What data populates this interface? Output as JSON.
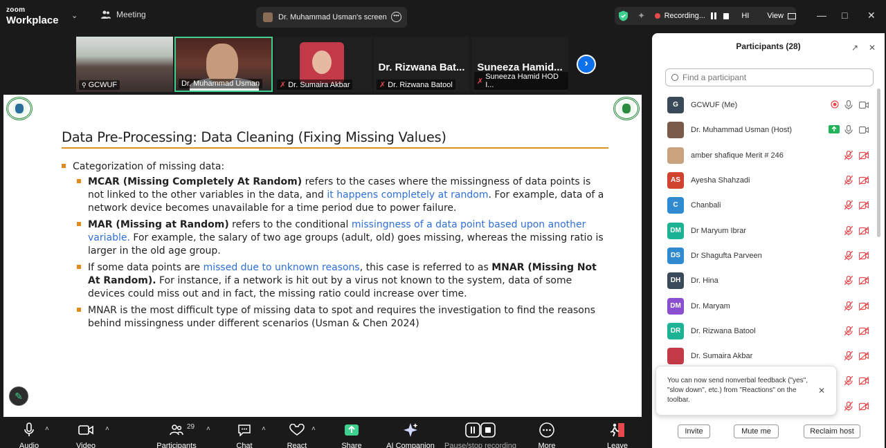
{
  "top": {
    "brand_small": "zoom",
    "brand_large": "Workplace",
    "meeting_tab": "Meeting",
    "screen_tab": "Dr. Muhammad Usman's screen",
    "recording_label": "Recording...",
    "hi_label": "HI",
    "view_label": "View"
  },
  "videos": {
    "tile1": "GCWUF",
    "tile2": "Dr. Muhammad Usman",
    "tile3": "Dr. Sumaira Akbar",
    "tile4_big": "Dr. Rizwana Bat...",
    "tile4": "Dr. Rizwana Batool",
    "tile5_big": "Suneeza Hamid...",
    "tile5": "Suneeza Hamid HOD I..."
  },
  "slide": {
    "title": "Data Pre-Processing: Data Cleaning (Fixing Missing Values)",
    "b0": "Categorization of missing data:",
    "b1_bold": "MCAR (Missing Completely At Random)",
    "b1_t1": " refers to the cases where the missingness of data points is not linked to the other variables in the data, and ",
    "b1_blue": "it happens completely at random",
    "b1_t2": ". For example, data of a network device becomes unavailable for a time period due to power failure.",
    "b2_bold": "MAR (Missing at Random)",
    "b2_t1": " refers to the conditional ",
    "b2_blue": "missingness of a data point based upon another variable.",
    "b2_t2": " For example, the salary of two age groups (adult, old) goes missing, whereas the missing ratio is larger in the old age group.",
    "b3_t1": "If some data points are ",
    "b3_blue": "missed due to unknown reasons",
    "b3_t2": ", this case is referred to as ",
    "b3_bold": "MNAR (Missing Not At Random).",
    "b3_t3": " For instance, if a network is hit out by a virus not known to the system, data of some devices could miss out and in fact, the missing ratio could increase over time.",
    "b4": "MNAR is the most difficult type of missing data to spot and requires the investigation to find the reasons behind missingness under different scenarios (Usman & Chen 2024)"
  },
  "panel": {
    "title": "Participants (28)",
    "search_placeholder": "Find a participant",
    "participants": [
      {
        "initials": "G",
        "name": "GCWUF (Me)",
        "color": "#3a4a5a"
      },
      {
        "initials": "",
        "name": "Dr. Muhammad Usman (Host)",
        "color": "#7a5a48"
      },
      {
        "initials": "",
        "name": "amber shafique Merit # 246",
        "color": "#c9a27e"
      },
      {
        "initials": "AS",
        "name": "Ayesha Shahzadi",
        "color": "#d0432f"
      },
      {
        "initials": "C",
        "name": "Chanbali",
        "color": "#2f8ad0"
      },
      {
        "initials": "DM",
        "name": "Dr Maryum Ibrar",
        "color": "#1bb394"
      },
      {
        "initials": "DS",
        "name": "Dr Shagufta Parveen",
        "color": "#2f8ad0"
      },
      {
        "initials": "DH",
        "name": "Dr. Hina",
        "color": "#3a4a5a"
      },
      {
        "initials": "DM",
        "name": "Dr. Maryam",
        "color": "#8a4ed0"
      },
      {
        "initials": "DR",
        "name": "Dr. Rizwana Batool",
        "color": "#1bb394"
      },
      {
        "initials": "",
        "name": "Dr. Sumaira Akbar",
        "color": "#c23a48"
      }
    ],
    "tooltip_text": "You can now send nonverbal feedback (\"yes\", \"slow down\", etc.) from \"Reactions\" on the toolbar.",
    "invite": "Invite",
    "mute_me": "Mute me",
    "reclaim_host": "Reclaim host"
  },
  "toolbar": {
    "audio": "Audio",
    "video": "Video",
    "participants": "Participants",
    "participants_count": "29",
    "chat": "Chat",
    "react": "React",
    "share": "Share",
    "ai": "AI Companion",
    "pause": "Pause/stop recording",
    "more": "More",
    "leave": "Leave"
  },
  "colors": {
    "accent_green": "#3fcf8e",
    "zoom_blue": "#0e71eb",
    "record_red": "#e5484d",
    "slide_orange": "#e08a1e",
    "link_blue": "#2f6fd6"
  }
}
